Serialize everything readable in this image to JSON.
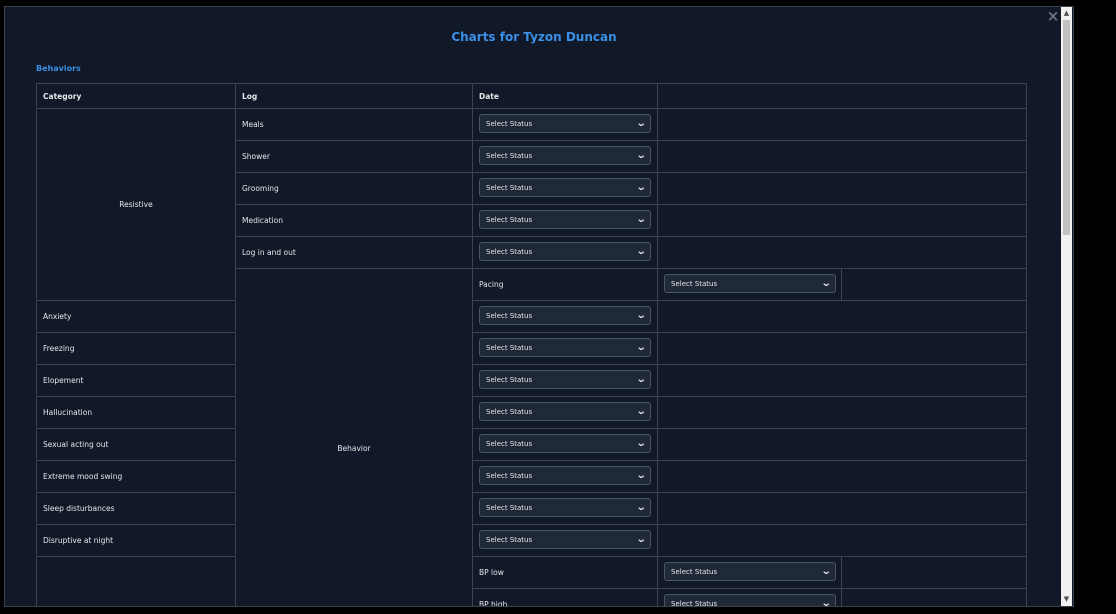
{
  "dialog": {
    "title": "Charts for Tyzon Duncan",
    "section": "Behaviors",
    "close_glyph": "×"
  },
  "table": {
    "headers": [
      "Category",
      "Log",
      "Date"
    ],
    "select_placeholder": "Select Status",
    "resistive_label": "Resistive",
    "behavior_label": "Behavior",
    "resistive_logs": [
      "Meals",
      "Shower",
      "Grooming",
      "Medication",
      "Log in and out"
    ],
    "pacing_label": "Pacing",
    "categories": [
      "Anxiety",
      "Freezing",
      "Elopement",
      "Hallucination",
      "Sexual acting out",
      "Extreme mood swing",
      "Sleep disturbances",
      "Disruptive at night"
    ],
    "bp_logs": [
      "BP low",
      "BP high"
    ]
  },
  "icons": {
    "chevron": "chevron-down-icon",
    "close": "close-icon"
  }
}
